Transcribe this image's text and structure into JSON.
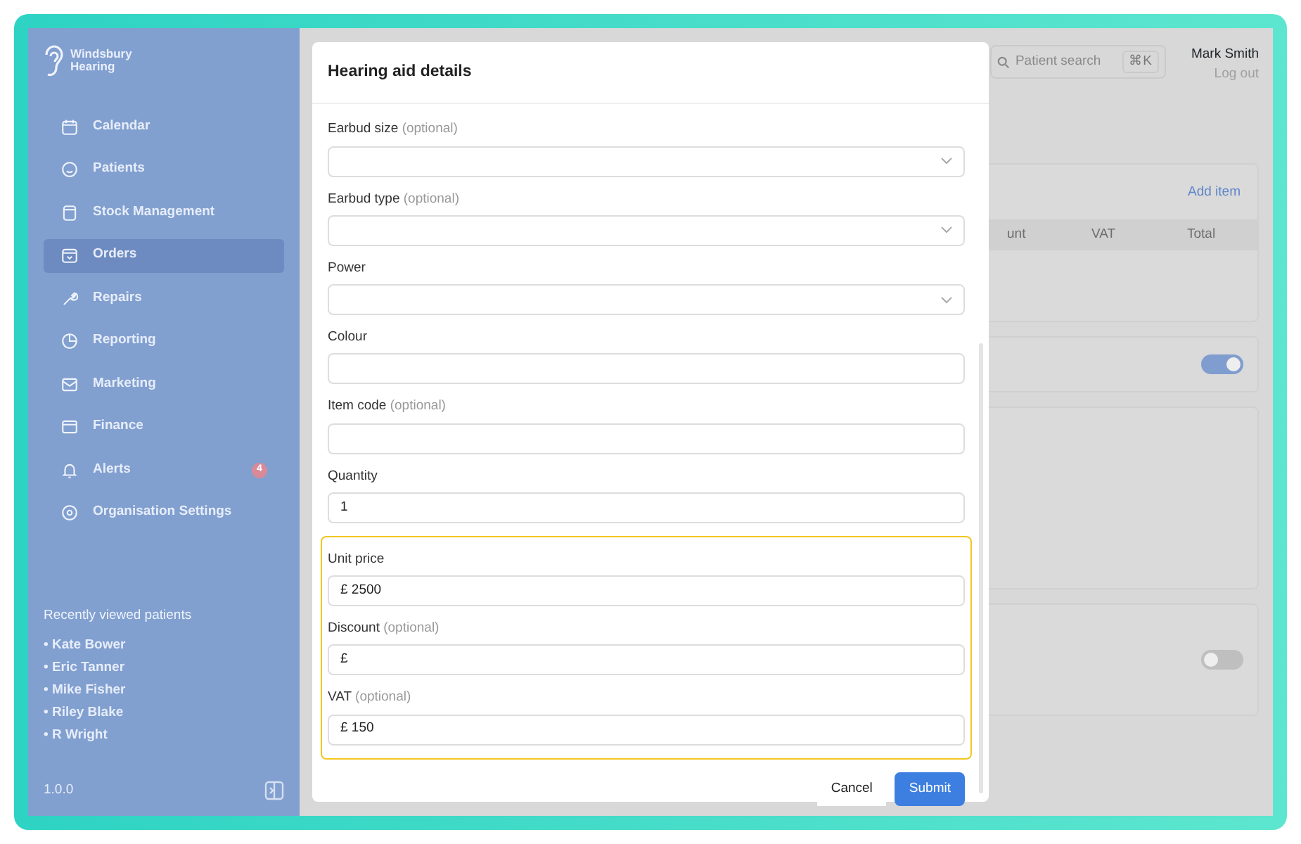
{
  "sidebar": {
    "brand": [
      "Windsbury",
      "Hearing"
    ],
    "items": [
      {
        "label": "Calendar",
        "selected": false
      },
      {
        "label": "Patients",
        "selected": false
      },
      {
        "label": "Stock Management",
        "selected": false
      },
      {
        "label": "Orders",
        "selected": true
      },
      {
        "label": "Repairs",
        "selected": false
      },
      {
        "label": "Reporting",
        "selected": false
      },
      {
        "label": "Marketing",
        "selected": false
      },
      {
        "label": "Finance",
        "selected": false
      },
      {
        "label": "Alerts",
        "selected": false,
        "badge": "4"
      },
      {
        "label": "Organisation Settings",
        "selected": false
      }
    ],
    "recent_title": "Recently viewed patients",
    "recent": [
      "• Kate Bower",
      "• Eric Tanner",
      "• Mike Fisher",
      "• Riley Blake",
      "• R Wright"
    ],
    "version": "1.0.0"
  },
  "header": {
    "search_placeholder": "Patient search",
    "shortcut": "⌘K",
    "user": "Mark Smith",
    "logout": "Log out"
  },
  "background": {
    "add_item": "Add item",
    "columns": [
      "unt",
      "VAT",
      "Total"
    ],
    "toggles": [
      {
        "on": true
      },
      {
        "on": false
      }
    ]
  },
  "modal": {
    "title": "Hearing aid details",
    "fields": [
      {
        "kind": "select",
        "label": "Earbud size",
        "optional": "(optional)"
      },
      {
        "kind": "select",
        "label": "Earbud type",
        "optional": "(optional)"
      },
      {
        "kind": "select",
        "label": "Power"
      },
      {
        "kind": "input",
        "label": "Colour"
      },
      {
        "kind": "input",
        "label": "Item code",
        "optional": "(optional)"
      },
      {
        "kind": "input",
        "label": "Quantity",
        "value": "1"
      }
    ],
    "highlighted_fields": [
      {
        "label": "Unit price",
        "value": "£ 2500"
      },
      {
        "label": "Discount",
        "optional": "(optional)",
        "value": "£"
      },
      {
        "label": "VAT",
        "optional": "(optional)",
        "value": "£ 150"
      }
    ],
    "buttons": [
      {
        "label": "Cancel",
        "kind": "secondary"
      },
      {
        "label": "Submit",
        "kind": "primary"
      }
    ]
  }
}
